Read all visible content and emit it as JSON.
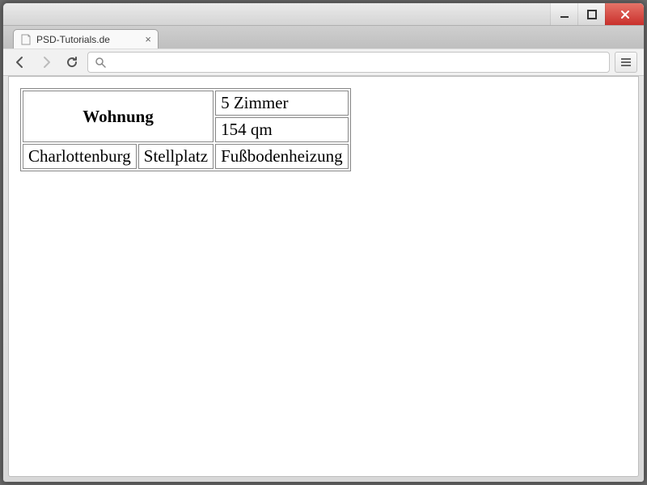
{
  "browser": {
    "tab_title": "PSD-Tutorials.de",
    "address": ""
  },
  "table": {
    "header": "Wohnung",
    "rooms": "5 Zimmer",
    "area": "154 qm",
    "district": "Charlottenburg",
    "parking": "Stellplatz",
    "heating": "Fußbodenheizung"
  }
}
